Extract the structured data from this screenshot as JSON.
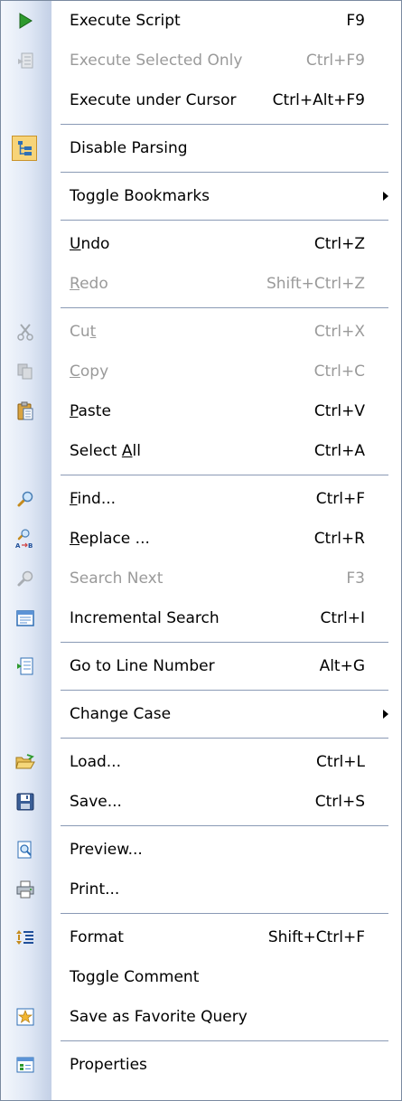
{
  "menu": {
    "execute_script": {
      "label": "Execute Script",
      "shortcut": "F9",
      "icon": "play-icon"
    },
    "execute_selected": {
      "label": "Execute Selected Only",
      "shortcut": "Ctrl+F9",
      "icon": "execute-selected-icon"
    },
    "execute_cursor": {
      "label": "Execute under Cursor",
      "shortcut": "Ctrl+Alt+F9"
    },
    "disable_parsing": {
      "label": "Disable Parsing",
      "icon": "parse-tree-icon"
    },
    "toggle_bookmarks": {
      "label": "Toggle Bookmarks"
    },
    "undo": {
      "label_u": "U",
      "label_rest": "ndo",
      "shortcut": "Ctrl+Z"
    },
    "redo": {
      "label_u": "R",
      "label_rest": "edo",
      "shortcut": "Shift+Ctrl+Z"
    },
    "cut": {
      "label_a": "Cu",
      "label_u": "t",
      "shortcut": "Ctrl+X",
      "icon": "scissors-icon"
    },
    "copy": {
      "label_u": "C",
      "label_rest": "opy",
      "shortcut": "Ctrl+C",
      "icon": "copy-icon"
    },
    "paste": {
      "label_u": "P",
      "label_rest": "aste",
      "shortcut": "Ctrl+V",
      "icon": "paste-icon"
    },
    "select_all": {
      "label_a": "Select ",
      "label_u": "A",
      "label_rest": "ll",
      "shortcut": "Ctrl+A"
    },
    "find": {
      "label_u": "F",
      "label_rest": "ind...",
      "shortcut": "Ctrl+F",
      "icon": "magnifier-icon"
    },
    "replace": {
      "label_u": "R",
      "label_rest": "eplace ...",
      "shortcut": "Ctrl+R",
      "icon": "replace-icon"
    },
    "search_next": {
      "label": "Search Next",
      "shortcut": "F3",
      "icon": "search-next-icon"
    },
    "incremental": {
      "label": "Incremental Search",
      "shortcut": "Ctrl+I",
      "icon": "incremental-search-icon"
    },
    "goto_line": {
      "label": "Go to Line Number",
      "shortcut": "Alt+G",
      "icon": "goto-line-icon"
    },
    "change_case": {
      "label": "Change Case"
    },
    "load": {
      "label": "Load...",
      "shortcut": "Ctrl+L",
      "icon": "open-folder-icon"
    },
    "save": {
      "label": "Save...",
      "shortcut": "Ctrl+S",
      "icon": "floppy-disk-icon"
    },
    "preview": {
      "label": "Preview...",
      "icon": "print-preview-icon"
    },
    "print": {
      "label": "Print...",
      "icon": "printer-icon"
    },
    "format": {
      "label": "Format",
      "shortcut": "Shift+Ctrl+F",
      "icon": "format-icon"
    },
    "toggle_comment": {
      "label": "Toggle Comment"
    },
    "favorite": {
      "label": "Save as Favorite Query",
      "icon": "star-icon"
    },
    "properties": {
      "label": "Properties",
      "icon": "properties-icon"
    }
  }
}
